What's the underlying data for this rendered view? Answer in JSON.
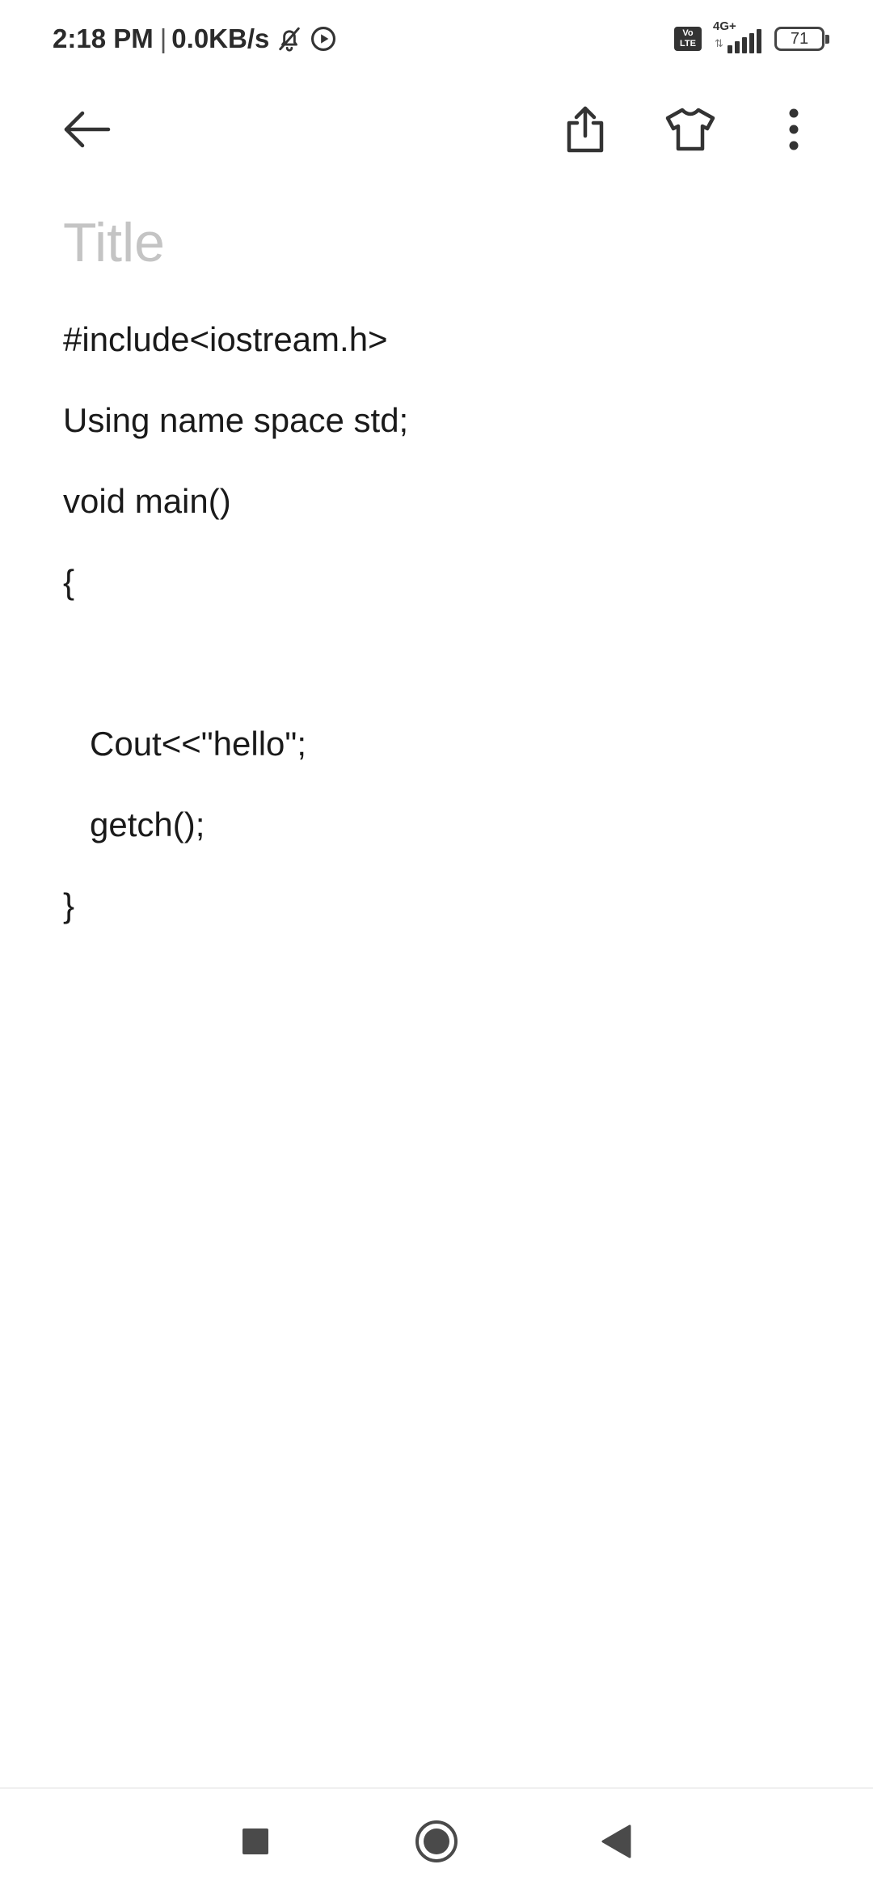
{
  "status_bar": {
    "time": "2:18 PM",
    "separator": "|",
    "data_speed": "0.0KB/s",
    "icons": [
      "bell-off-icon",
      "play-circle-icon"
    ],
    "volte_top": "Vo",
    "volte_bottom": "LTE",
    "network_type": "4G+",
    "network_arrows": "⇅",
    "signal_icon": "signal-bars-icon",
    "battery_level": "71"
  },
  "toolbar": {
    "back_icon": "arrow-back-icon",
    "share_icon": "share-icon",
    "theme_icon": "tshirt-icon",
    "more_icon": "more-vertical-icon"
  },
  "note": {
    "title_value": "",
    "title_placeholder": "Title",
    "lines": [
      "#include<iostream.h>",
      "Using name space std;",
      "void main()",
      "{",
      "",
      "Cout<<\"hello\";",
      "getch();",
      "}"
    ]
  },
  "nav_bar": {
    "recents_icon": "square-stop-icon",
    "home_icon": "circle-home-icon",
    "back_icon": "triangle-back-icon"
  },
  "colors": {
    "text": "#1a1a1a",
    "placeholder": "#c4c4c4",
    "icon": "#333333",
    "nav_icon": "#4a4a4a",
    "background": "#ffffff"
  }
}
